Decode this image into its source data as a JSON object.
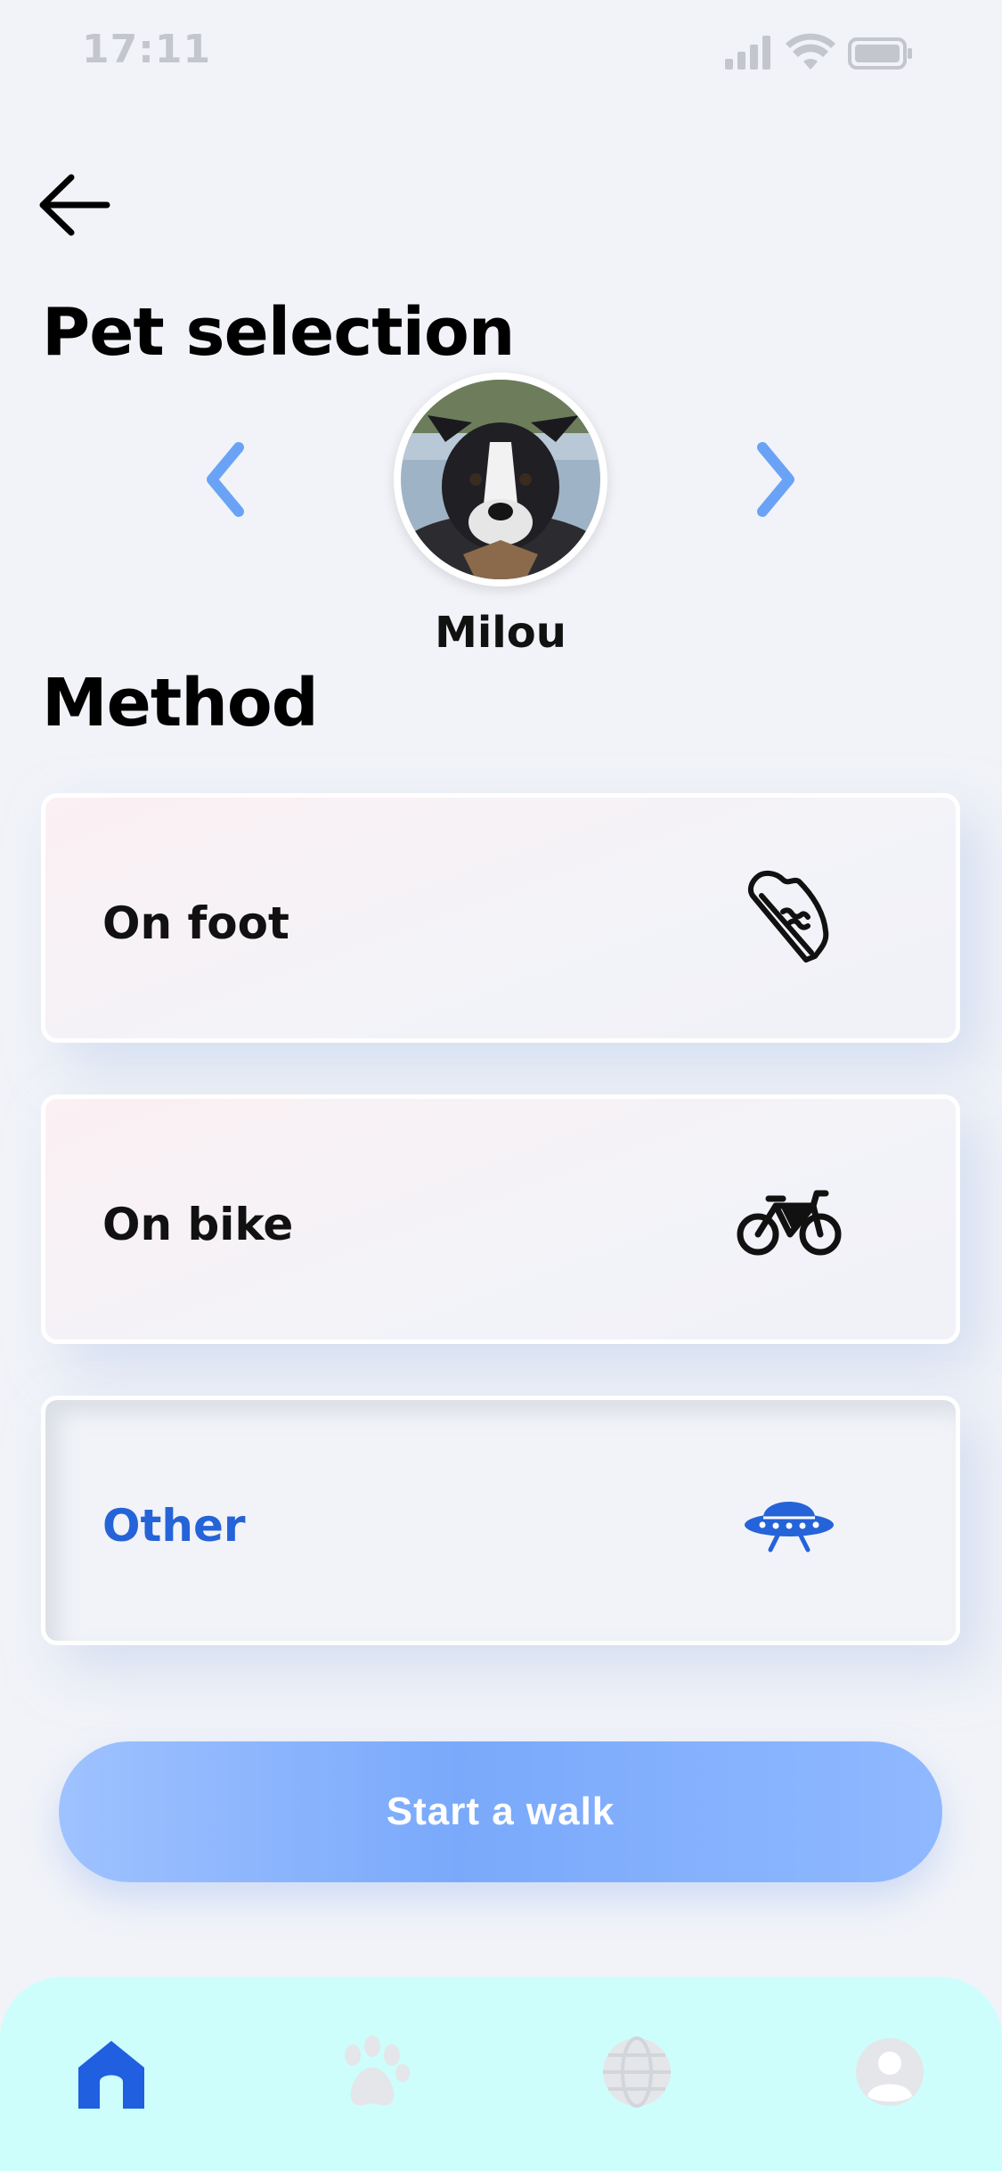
{
  "status_bar": {
    "time": "17:11"
  },
  "page": {
    "title": "Pet selection"
  },
  "pet": {
    "name": "Milou"
  },
  "method": {
    "heading": "Method",
    "options": [
      {
        "label": "On foot",
        "icon": "sneaker-icon",
        "selected": false
      },
      {
        "label": "On bike",
        "icon": "bicycle-icon",
        "selected": false
      },
      {
        "label": "Other",
        "icon": "ufo-icon",
        "selected": true
      }
    ]
  },
  "actions": {
    "start_label": "Start a walk"
  },
  "tabs": [
    {
      "icon": "home-icon",
      "active": true
    },
    {
      "icon": "paw-icon",
      "active": false
    },
    {
      "icon": "globe-icon",
      "active": false
    },
    {
      "icon": "profile-icon",
      "active": false
    }
  ],
  "colors": {
    "accent": "#2563d8",
    "chevron": "#6aa3f5",
    "button": "#7aa9fb",
    "tabbar": "#cdfefb",
    "inactive_tab": "#e4e6ea"
  }
}
